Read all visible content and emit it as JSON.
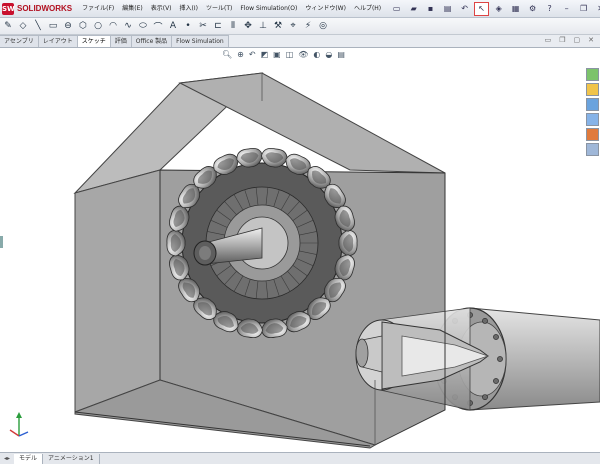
{
  "app": {
    "logo_badge": "SW",
    "name": "SOLIDWORKS"
  },
  "menu": {
    "items": [
      "ファイル(F)",
      "編集(E)",
      "表示(V)",
      "挿入(I)",
      "ツール(T)",
      "Flow Simulation(O)",
      "ウィンドウ(W)",
      "ヘルプ(H)"
    ]
  },
  "command_tabs": {
    "items": [
      "アセンブリ",
      "レイアウト",
      "スケッチ",
      "評価",
      "Office 製品",
      "Flow Simulation"
    ],
    "active_index": 2
  },
  "model_tabs": {
    "items": [
      "モデル",
      "アニメーション1"
    ],
    "active_index": 0
  },
  "colors": {
    "brand": "#c8102e",
    "shell": "#8e8e8e",
    "metal": "#9a9a9a"
  },
  "icons": {
    "headsup": [
      "zoom-fit-icon",
      "zoom-area-icon",
      "previous-view-icon",
      "section-view-icon",
      "view-orientation-icon",
      "display-style-icon",
      "hide-show-icon",
      "edit-appearance-icon",
      "apply-scene-icon",
      "view-settings-icon"
    ],
    "taskpane": [
      "resources-icon",
      "design-library-icon",
      "file-explorer-icon",
      "view-palette-icon",
      "appearances-icon",
      "custom-properties-icon"
    ]
  }
}
